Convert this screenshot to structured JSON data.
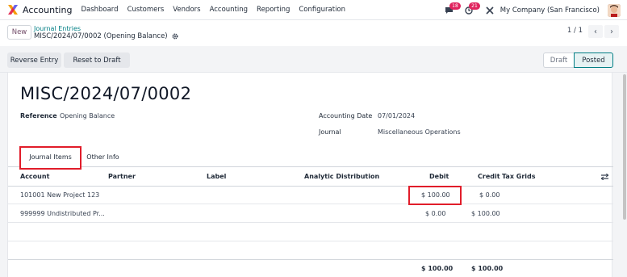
{
  "app": {
    "name": "Accounting",
    "menu": [
      "Dashboard",
      "Customers",
      "Vendors",
      "Accounting",
      "Reporting",
      "Configuration"
    ],
    "messages_count": "18",
    "activities_count": "21",
    "company": "My Company (San Francisco)"
  },
  "control": {
    "new_label": "New",
    "breadcrumb_parent": "Journal Entries",
    "breadcrumb_current": "MISC/2024/07/0002 (Opening Balance)",
    "pager": "1 / 1"
  },
  "actions": {
    "reverse_entry": "Reverse Entry",
    "reset_to_draft": "Reset to Draft",
    "status_draft": "Draft",
    "status_posted": "Posted"
  },
  "record": {
    "title": "MISC/2024/07/0002",
    "reference_label": "Reference",
    "reference_value": "Opening Balance",
    "accounting_date_label": "Accounting Date",
    "accounting_date_value": "07/01/2024",
    "journal_label": "Journal",
    "journal_value": "Miscellaneous Operations"
  },
  "tabs": [
    "Journal Items",
    "Other Info"
  ],
  "table": {
    "columns": [
      "Account",
      "Partner",
      "Label",
      "Analytic Distribution",
      "Debit",
      "Credit",
      "Tax Grids"
    ],
    "rows": [
      {
        "account": "101001 New Project 123",
        "debit": "$ 100.00",
        "credit": "$ 0.00"
      },
      {
        "account": "999999 Undistributed Pr...",
        "debit": "$ 0.00",
        "credit": "$ 100.00"
      }
    ],
    "total_debit": "$ 100.00",
    "total_credit": "$ 100.00"
  },
  "colors": {
    "brand": "#714b67",
    "accent": "#017e84",
    "highlight": "#e11d2a"
  }
}
